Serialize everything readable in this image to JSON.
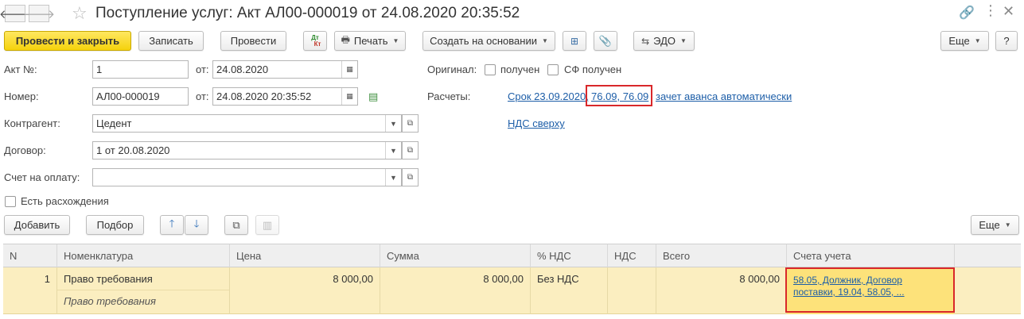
{
  "window": {
    "title": "Поступление услуг: Акт АЛ00-000019 от 24.08.2020 20:35:52"
  },
  "toolbar": {
    "post_close": "Провести и закрыть",
    "save": "Записать",
    "post": "Провести",
    "dtkt_top": "Дт",
    "dtkt_bottom": "Кт",
    "print": "Печать",
    "create_based": "Создать на основании",
    "edo": "ЭДО",
    "more": "Еще",
    "help": "?"
  },
  "form": {
    "act_no_label": "Акт №:",
    "act_no_value": "1",
    "from_label": "от:",
    "act_date": "24.08.2020",
    "number_label": "Номер:",
    "number_value": "АЛ00-000019",
    "number_date": "24.08.2020 20:35:52",
    "counterparty_label": "Контрагент:",
    "counterparty_value": "Цедент",
    "contract_label": "Договор:",
    "contract_value": "1 от 20.08.2020",
    "invoice_label": "Счет на оплату:",
    "invoice_value": "",
    "discrepancy_label": "Есть расхождения",
    "original_label": "Оригинал:",
    "received_label": "получен",
    "sf_received_label": "СФ получен",
    "settlements_label": "Расчеты:",
    "settlements_term": "Срок 23.09.2020,",
    "settlements_accounts": "76.09, 76.09",
    "settlements_advance": "зачет аванса автоматически",
    "vat_link": "НДС сверху"
  },
  "table_toolbar": {
    "add": "Добавить",
    "pick": "Подбор",
    "more": "Еще"
  },
  "table": {
    "columns": [
      "N",
      "Номенклатура",
      "Цена",
      "Сумма",
      "% НДС",
      "НДС",
      "Всего",
      "Счета учета"
    ],
    "rows": [
      {
        "n": "1",
        "item": "Право требования",
        "item_content": "Право требования",
        "price": "8 000,00",
        "sum": "8 000,00",
        "vat_rate": "Без НДС",
        "vat": "",
        "total": "8 000,00",
        "accounts_line1": "58.05, Должник, Договор",
        "accounts_line2": "поставки, 19.04, 58.05, ..."
      }
    ]
  },
  "colors": {
    "primary_button": "#f5d20c",
    "link": "#1d5ea8",
    "highlight_box": "#d9282a",
    "selected_row": "#fbeec0"
  }
}
